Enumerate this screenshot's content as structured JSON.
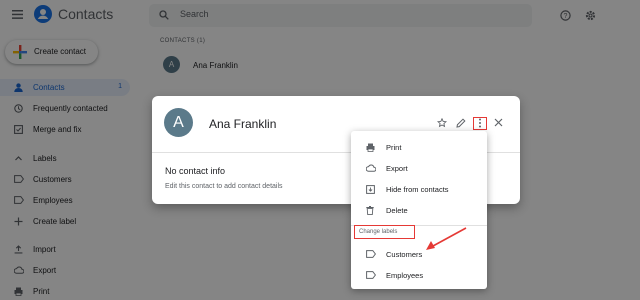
{
  "app": {
    "title": "Contacts"
  },
  "search": {
    "placeholder": "Search"
  },
  "sidebar": {
    "create_label": "Create contact",
    "items": [
      {
        "label": "Contacts",
        "count": "1"
      },
      {
        "label": "Frequently contacted"
      },
      {
        "label": "Merge and fix"
      },
      {
        "label": "Labels"
      },
      {
        "label": "Customers"
      },
      {
        "label": "Employees"
      },
      {
        "label": "Create label"
      },
      {
        "label": "Import"
      },
      {
        "label": "Export"
      },
      {
        "label": "Print"
      }
    ]
  },
  "main": {
    "section_header": "CONTACTS (1)",
    "contact": {
      "initial": "A",
      "name": "Ana Franklin"
    }
  },
  "dialog": {
    "initial": "A",
    "name": "Ana Franklin",
    "heading": "No contact info",
    "subtext": "Edit this contact to add contact details"
  },
  "menu": {
    "items": [
      {
        "label": "Print"
      },
      {
        "label": "Export"
      },
      {
        "label": "Hide from contacts"
      },
      {
        "label": "Delete"
      }
    ],
    "change_labels": "Change labels",
    "labels": [
      {
        "label": "Customers"
      },
      {
        "label": "Employees"
      }
    ]
  },
  "colors": {
    "accent": "#1a73e8",
    "annotation": "#e53935",
    "avatar": "#5b7a8a"
  }
}
